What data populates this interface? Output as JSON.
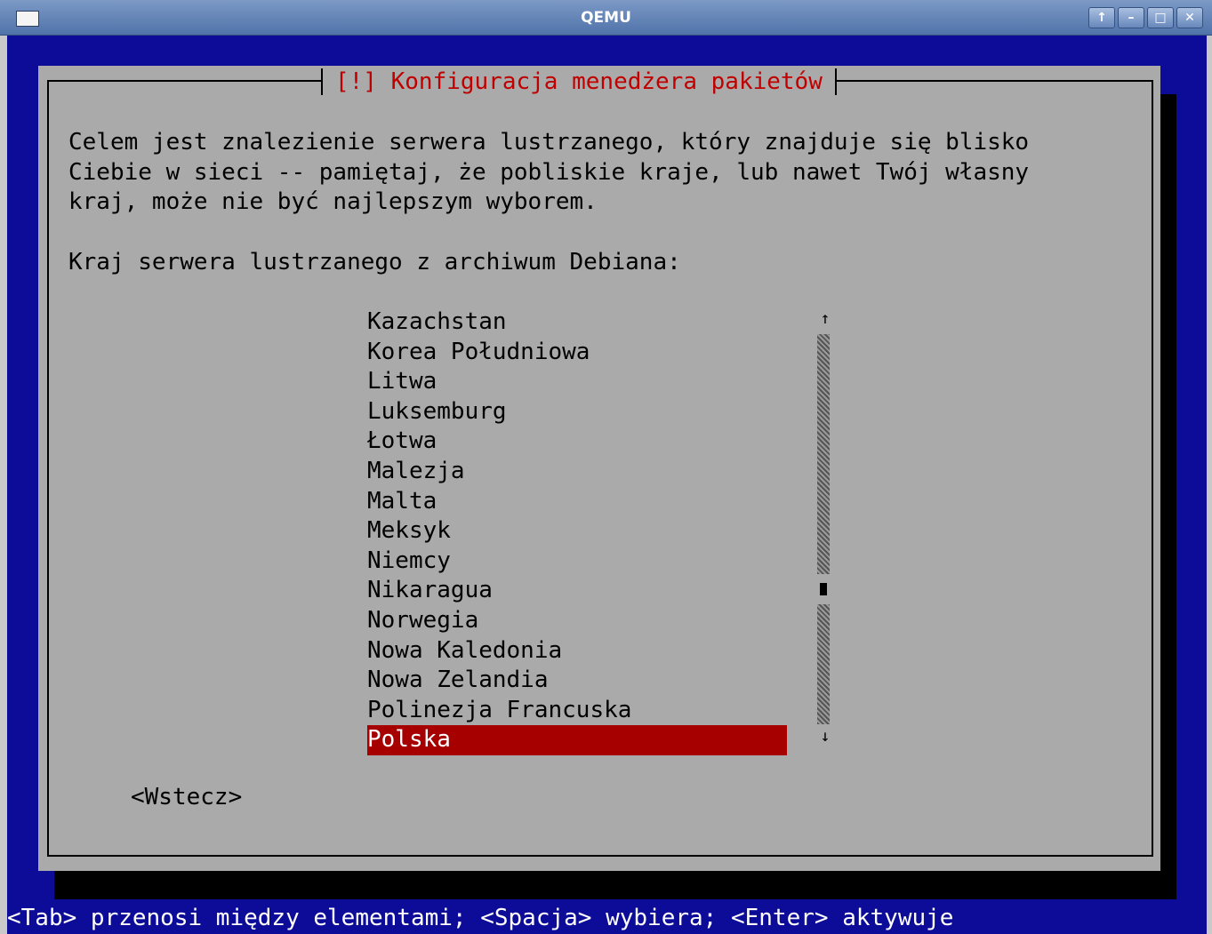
{
  "window": {
    "title": "QEMU",
    "buttons": [
      "↑",
      "–",
      "□",
      "✕"
    ]
  },
  "dialog": {
    "title": "[!] Konfiguracja menedżera pakietów",
    "description": [
      "Celem jest znalezienie serwera lustrzanego, który znajduje się blisko",
      "Ciebie w sieci -- pamiętaj, że pobliskie kraje, lub nawet Twój własny",
      "kraj, może nie być najlepszym wyborem."
    ],
    "prompt": "Kraj serwera lustrzanego z archiwum Debiana:",
    "countries": [
      "Kazachstan",
      "Korea Południowa",
      "Litwa",
      "Luksemburg",
      "Łotwa",
      "Malezja",
      "Malta",
      "Meksyk",
      "Niemcy",
      "Nikaragua",
      "Norwegia",
      "Nowa Kaledonia",
      "Nowa Zelandia",
      "Polinezja Francuska",
      "Polska"
    ],
    "selected": "Polska",
    "scroll_up": "↑",
    "scroll_down": "↓",
    "back_button": "<Wstecz>"
  },
  "status_bar": "<Tab> przenosi między elementami; <Spacja> wybiera; <Enter> aktywuje",
  "colors": {
    "background": "#0c0c98",
    "dialog": "#aaaaaa",
    "title_text": "#c00000",
    "selection": "#a60000"
  }
}
